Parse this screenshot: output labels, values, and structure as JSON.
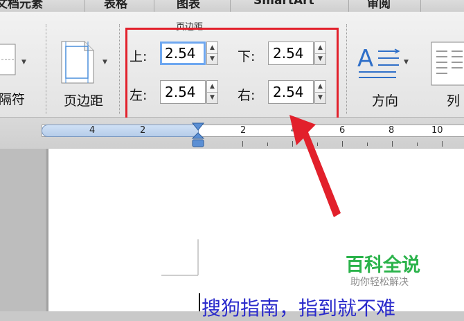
{
  "tabs": [
    "文档元素",
    "表格",
    "图表",
    "SmartArt",
    "审阅"
  ],
  "ribbon": {
    "left_button_label": "隔符",
    "margins_button_label": "页边距",
    "group_title": "页边距",
    "fields": {
      "top": {
        "label": "上:",
        "value": "2.54"
      },
      "bottom": {
        "label": "下:",
        "value": "2.54"
      },
      "left": {
        "label": "左:",
        "value": "2.54"
      },
      "right": {
        "label": "右:",
        "value": "2.54"
      }
    },
    "orientation_label": "方向",
    "columns_label": "列"
  },
  "ruler": {
    "numbers": [
      "4",
      "2",
      "2",
      "4",
      "6",
      "8",
      "10"
    ]
  },
  "watermark": {
    "title": "百科全说",
    "subtitle": "助你轻松解决"
  },
  "document": {
    "text": "搜狗指南，指到就不难"
  },
  "colors": {
    "highlight": "#e2202b",
    "arrow": "#e2202b",
    "watermark": "#2bb34b",
    "doc_text": "#2a2acb",
    "focus_ring": "#6ea7f0"
  }
}
